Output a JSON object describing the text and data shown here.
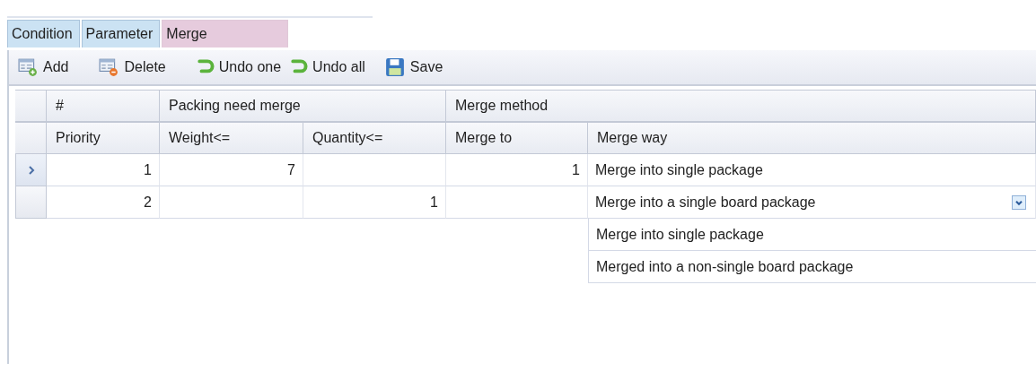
{
  "tabs": [
    {
      "label": "Condition",
      "selected": false
    },
    {
      "label": "Parameter",
      "selected": false
    },
    {
      "label": "Merge",
      "selected": true
    }
  ],
  "toolbar": [
    {
      "kind": "add",
      "label": "Add"
    },
    {
      "kind": "delete",
      "label": "Delete"
    },
    {
      "kind": "undo",
      "label": "Undo one"
    },
    {
      "kind": "undo",
      "label": "Undo all"
    },
    {
      "kind": "save",
      "label": "Save"
    }
  ],
  "table": {
    "header_groups": [
      {
        "label": "#",
        "columns": [
          "Priority"
        ]
      },
      {
        "label": "Packing need merge",
        "columns": [
          "Weight<=",
          "Quantity<="
        ]
      },
      {
        "label": "Merge method",
        "columns": [
          "Merge to",
          "Merge way"
        ]
      }
    ],
    "rows": [
      {
        "selected": true,
        "cells": [
          "1",
          "7",
          null,
          "1",
          "Merge into single package"
        ]
      },
      {
        "selected": false,
        "cells": [
          "2",
          null,
          "1",
          null,
          "Merge into a single board package"
        ],
        "dropdown": {
          "open": true,
          "options": [
            "Merge into single package",
            "Merged into a non-single board package"
          ]
        }
      }
    ]
  }
}
